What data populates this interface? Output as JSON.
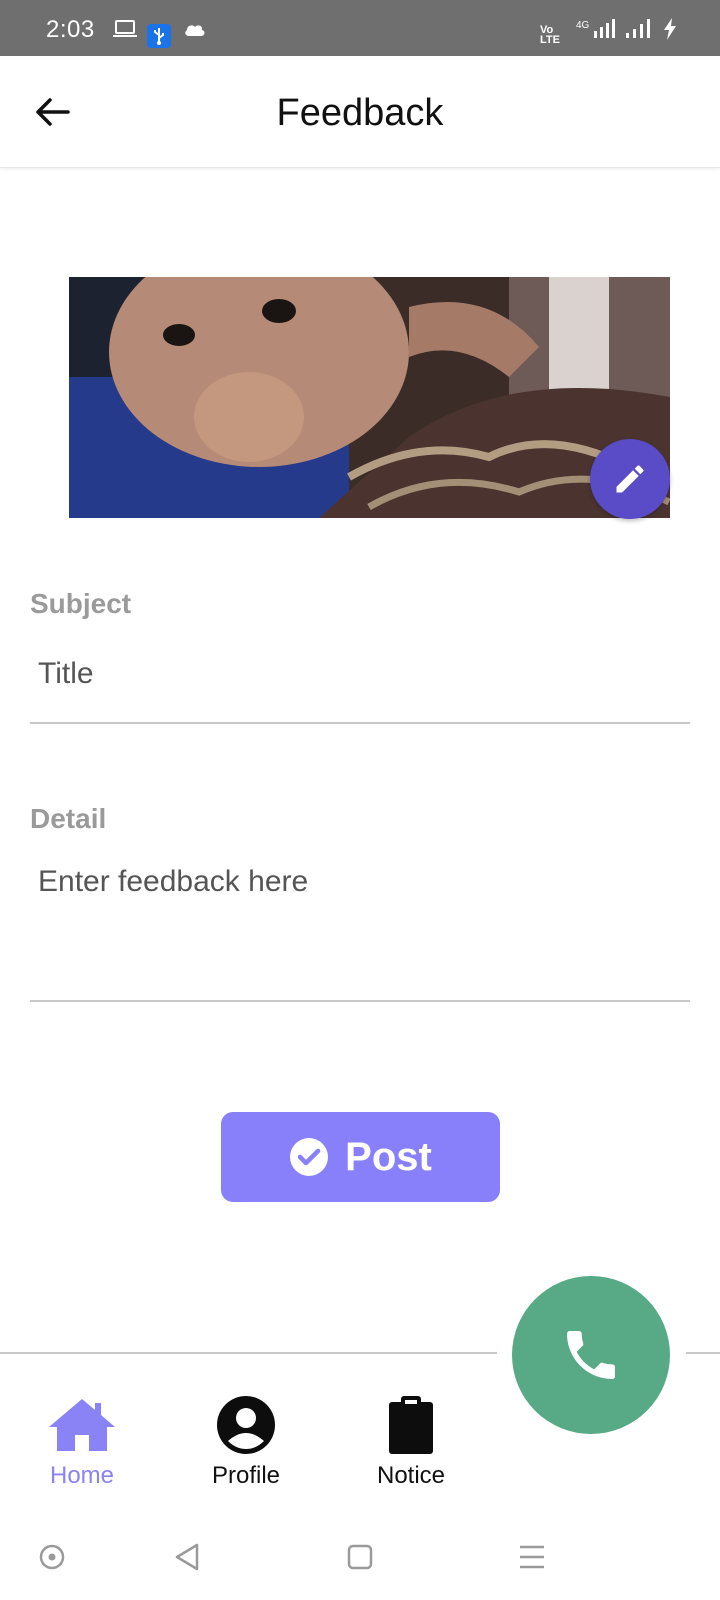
{
  "status_bar": {
    "time": "2:03",
    "volte": "Vo LTE",
    "network": "4G",
    "icons": [
      "laptop-icon",
      "usb-icon",
      "cloud-icon",
      "volte-icon",
      "signal-4g-icon",
      "signal-icon",
      "charging-icon"
    ]
  },
  "app_bar": {
    "title": "Feedback",
    "back_icon": "arrow-left-icon"
  },
  "image": {
    "edit_icon": "pencil-icon"
  },
  "form": {
    "subject": {
      "label": "Subject",
      "placeholder": "Title",
      "value": ""
    },
    "detail": {
      "label": "Detail",
      "placeholder": "Enter feedback here",
      "value": ""
    }
  },
  "post_button": {
    "label": "Post",
    "icon": "check-circle-icon"
  },
  "call_button": {
    "icon": "phone-icon"
  },
  "bottom_nav": {
    "items": [
      {
        "label": "Home",
        "icon": "home-icon",
        "active": true
      },
      {
        "label": "Profile",
        "icon": "account-circle-icon",
        "active": false
      },
      {
        "label": "Notice",
        "icon": "clipboard-icon",
        "active": false
      }
    ]
  },
  "system_nav": {
    "icons": [
      "dot-icon",
      "back-triangle-icon",
      "square-icon",
      "menu-icon"
    ]
  },
  "colors": {
    "accent": "#8880fb",
    "edit_fab": "#5a4bc6",
    "call_fab": "#58aa87",
    "label_gray": "#9a9a9a",
    "status_bar": "#6f6f6f"
  }
}
